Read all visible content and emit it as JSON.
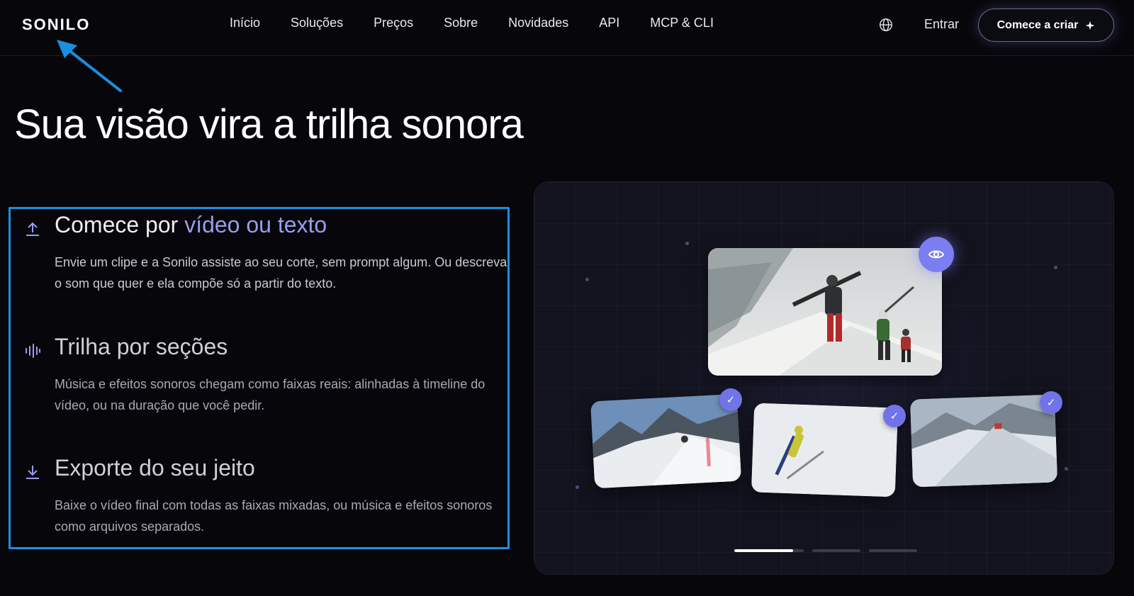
{
  "header": {
    "logo": "SONILO",
    "nav": [
      "Início",
      "Soluções",
      "Preços",
      "Sobre",
      "Novidades",
      "API",
      "MCP & CLI"
    ],
    "signin_label": "Entrar",
    "cta_label": "Comece a criar",
    "cta_icon": "sparkle-icon",
    "language_icon": "globe-icon"
  },
  "hero": {
    "title": "Sua visão vira a trilha sonora"
  },
  "features": [
    {
      "icon": "upload-icon",
      "title_plain": "Comece por ",
      "title_accent": "vídeo ou texto",
      "body": "Envie um clipe e a Sonilo assiste ao seu corte, sem prompt algum. Ou descreva o som que quer e ela compõe só a partir do texto."
    },
    {
      "icon": "waveform-icon",
      "title": "Trilha por seções",
      "body": "Música e efeitos sonoros chegam como faixas reais: alinhadas à timeline do vídeo, ou na duração que você pedir."
    },
    {
      "icon": "download-icon",
      "title": "Exporte do seu jeito",
      "body": "Baixe o vídeo final com todas as faixas mixadas, ou música e efeitos sonoros como arquivos separados."
    }
  ],
  "preview": {
    "main_card": "ski-mountaineers-image",
    "thumbnails": [
      "snowboard-slope-image",
      "ski-jumper-image",
      "skier-powder-image"
    ],
    "selected_icon": "check-icon",
    "preview_icon": "eye-icon",
    "carousel": {
      "pages": 3,
      "active": 1,
      "progress": 0.85
    }
  },
  "colors": {
    "background": "#07070b",
    "accent": "#9a9cf0",
    "button_accent": "#7b7ef0",
    "annotation": "#1a8fe0"
  }
}
